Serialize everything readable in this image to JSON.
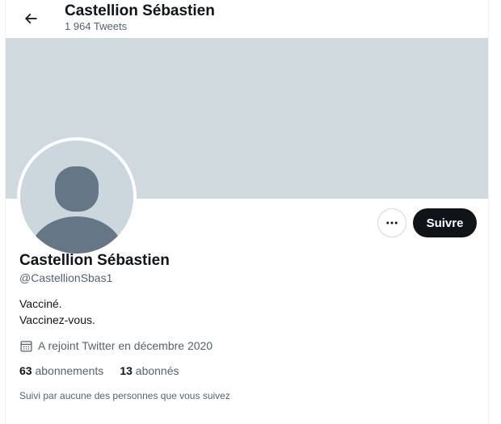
{
  "header": {
    "title": "Castellion Sébastien",
    "tweet_count": "1 964 Tweets",
    "back_icon": "arrow-left-icon"
  },
  "profile": {
    "display_name": "Castellion Sébastien",
    "handle": "@CastellionSbas1",
    "bio_lines": [
      "Vacciné.",
      "Vaccinez-vous."
    ],
    "joined": "A rejoint Twitter en décembre 2020",
    "joined_icon": "calendar-icon",
    "following_count": "63",
    "following_label": "abonnements",
    "followers_count": "13",
    "followers_label": "abonnés",
    "followed_by": "Suivi par aucune des personnes que vous suivez"
  },
  "actions": {
    "more_icon": "more-options-icon",
    "follow_label": "Suivre"
  },
  "colors": {
    "banner": "#cfd9de",
    "avatar_bg": "#ccd6dd",
    "avatar_figure": "#657786",
    "follow_button": "#0f1419",
    "secondary_text": "#536471"
  }
}
